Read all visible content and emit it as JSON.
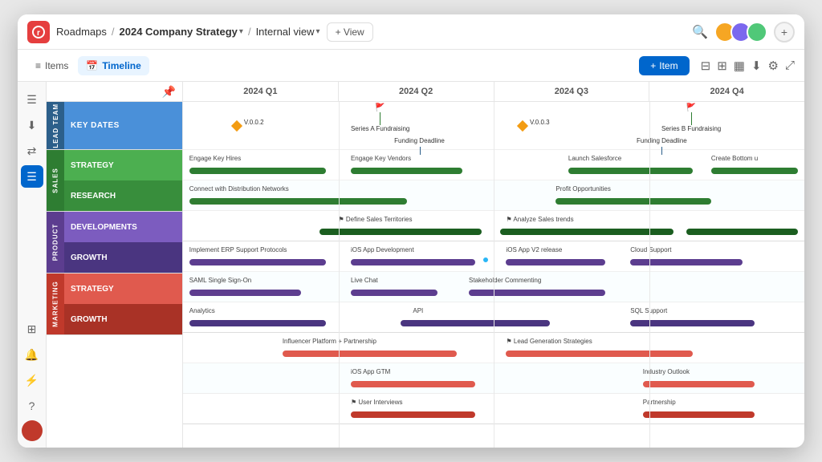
{
  "app": {
    "logo": "R",
    "breadcrumb": {
      "root": "Roadmaps",
      "separator": "/",
      "page": "2024 Company Strategy",
      "view": "Internal view"
    },
    "add_view_label": "+ View"
  },
  "toolbar": {
    "items_label": "Items",
    "timeline_label": "Timeline",
    "add_item_label": "+ Item"
  },
  "quarters": [
    "2024 Q1",
    "2024 Q2",
    "2024 Q3",
    "2024 Q4"
  ],
  "groups": {
    "lead_team": {
      "label": "LEAD TEAM",
      "section": "KEY DATES",
      "color_group": "#2c5f8a",
      "color_section": "#4a90d9"
    },
    "sales": {
      "label": "SALES",
      "sections": [
        "STRATEGY",
        "RESEARCH"
      ],
      "color_group": "#2e7d32",
      "color_strategy": "#4caf50",
      "color_research": "#388e3c"
    },
    "product": {
      "label": "PRODUCT",
      "sections": [
        "DEVELOPMENTS",
        "GROWTH"
      ],
      "color_group": "#5c3d8f",
      "color_dev": "#7c5cbf",
      "color_growth": "#4a3580"
    },
    "marketing": {
      "label": "MARKETING",
      "sections": [
        "STRATEGY",
        "GROWTH"
      ],
      "color_group": "#c0392b",
      "color_strategy": "#e05a4e",
      "color_growth": "#c0392b"
    }
  },
  "milestones": [
    {
      "label": "V.0.0.2",
      "position_pct": 10
    },
    {
      "label": "V.0.0.3",
      "position_pct": 55
    }
  ],
  "flags": [
    {
      "label": "Series A Fundraising",
      "position_pct": 28
    },
    {
      "label": "Series B Fundraising",
      "position_pct": 80
    }
  ],
  "funding_deadlines": [
    {
      "label": "Funding Deadline",
      "position_pct": 36
    },
    {
      "label": "Funding Deadline",
      "position_pct": 74
    }
  ],
  "sidebar_icons": [
    "☰",
    "↓",
    "⇄",
    "☰"
  ],
  "sidebar_bottom_icons": [
    "⊞",
    "🔔",
    "⚡",
    "?"
  ]
}
